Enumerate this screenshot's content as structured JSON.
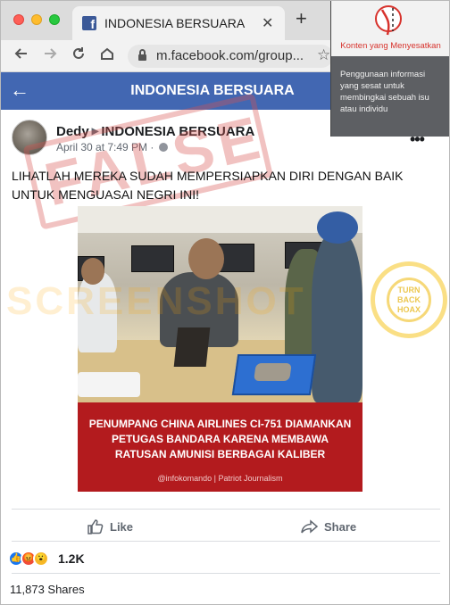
{
  "browser": {
    "tab_title": "INDONESIA BERSUARA",
    "tab_close": "✕",
    "new_tab": "+",
    "url": "m.facebook.com/group..."
  },
  "header": {
    "title": "INDONESIA BERSUARA",
    "back": "←"
  },
  "post": {
    "author": "Dedy",
    "group": "INDONESIA BERSUARA",
    "time": "April 30 at 7:49 PM · ",
    "text": "LIHATLAH MEREKA SUDAH MEMPERSIAPKAN DIRI DENGAN BAIK UNTUK MENGUASAI NEGRI INI!",
    "image_caption": "PENUMPANG CHINA AIRLINES CI-751 DIAMANKAN PETUGAS BANDARA KARENA MEMBAWA RATUSAN AMUNISI BERBAGAI KALIBER",
    "image_credit": "@infokomando | Patriot Journalism",
    "stamp": "FALSE",
    "watermark": "SCREENSHOT",
    "seal": "TURN BACK HOAX"
  },
  "actions": {
    "like": "Like",
    "share": "Share"
  },
  "stats": {
    "reactions": "1.2K",
    "shares": "11,873 Shares"
  },
  "misinfo": {
    "title": "Konten yang Menyesatkan",
    "body": "Penggunaan informasi yang sesat untuk membingkai sebuah isu atau individu"
  },
  "menu": "•••",
  "colors": {
    "fb_blue": "#4267b2",
    "caption_red": "#b31b1e",
    "stamp_red": "#d9534f",
    "misinfo_red": "#d7332d"
  }
}
